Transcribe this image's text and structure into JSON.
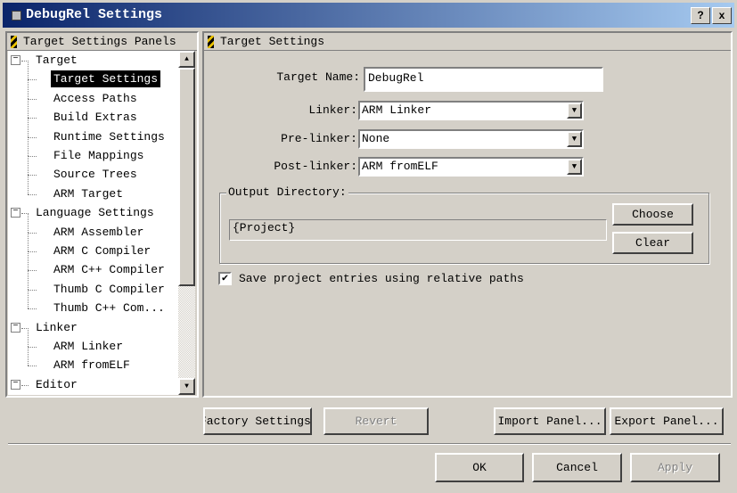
{
  "window": {
    "title": "DebugRel Settings",
    "help": "?",
    "close": "x"
  },
  "left_panel": {
    "title": "Target Settings Panels",
    "tree": [
      {
        "label": "Target",
        "level": 0
      },
      {
        "label": "Target Settings",
        "level": 1,
        "selected": true
      },
      {
        "label": "Access Paths",
        "level": 1
      },
      {
        "label": "Build Extras",
        "level": 1
      },
      {
        "label": "Runtime Settings",
        "level": 1
      },
      {
        "label": "File Mappings",
        "level": 1
      },
      {
        "label": "Source Trees",
        "level": 1
      },
      {
        "label": "ARM Target",
        "level": 1
      },
      {
        "label": "Language Settings",
        "level": 0
      },
      {
        "label": "ARM Assembler",
        "level": 1
      },
      {
        "label": "ARM C Compiler",
        "level": 1
      },
      {
        "label": "ARM C++ Compiler",
        "level": 1
      },
      {
        "label": "Thumb C Compiler",
        "level": 1
      },
      {
        "label": "Thumb C++ Com...",
        "level": 1
      },
      {
        "label": "Linker",
        "level": 0
      },
      {
        "label": "ARM Linker",
        "level": 1
      },
      {
        "label": "ARM fromELF",
        "level": 1
      },
      {
        "label": "Editor",
        "level": 0
      }
    ]
  },
  "right_panel": {
    "title": "Target Settings",
    "target_name_label": "Target Name:",
    "target_name": "DebugRel",
    "linker_label": "Linker:",
    "linker": "ARM Linker",
    "prelinker_label": "Pre-linker:",
    "prelinker": "None",
    "postlinker_label": "Post-linker:",
    "postlinker": "ARM fromELF",
    "output_dir_label": "Output Directory:",
    "output_dir": "{Project}",
    "choose": "Choose",
    "clear": "Clear",
    "relative_paths_label": "Save project entries using relative paths",
    "relative_paths_checked": true
  },
  "buttons": {
    "factory": "Factory Settings",
    "revert": "Revert",
    "import": "Import Panel...",
    "export": "Export Panel...",
    "ok": "OK",
    "cancel": "Cancel",
    "apply": "Apply"
  }
}
